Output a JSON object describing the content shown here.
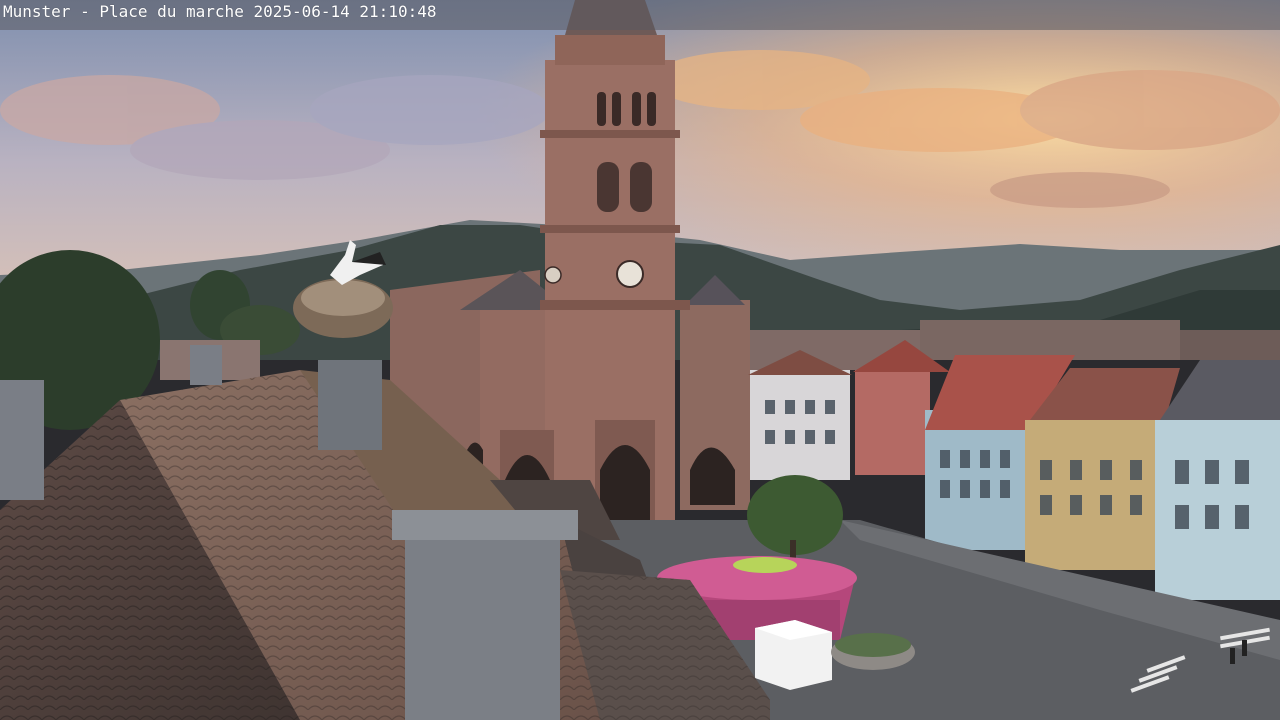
{
  "overlay": {
    "caption": "Munster - Place du marche 2025-06-14 21:10:48"
  },
  "scene": {
    "description_icons": [
      "church-tower",
      "stork-nest",
      "carousel",
      "roofs",
      "mountains",
      "sunset-sky"
    ],
    "colors": {
      "sky_top": "#8e9bb3",
      "sky_glow": "#f6c27e",
      "mountain": "#3e4a47",
      "church": "#9a6e64",
      "roof": "#6e5650",
      "carousel": "#c8578a"
    }
  }
}
